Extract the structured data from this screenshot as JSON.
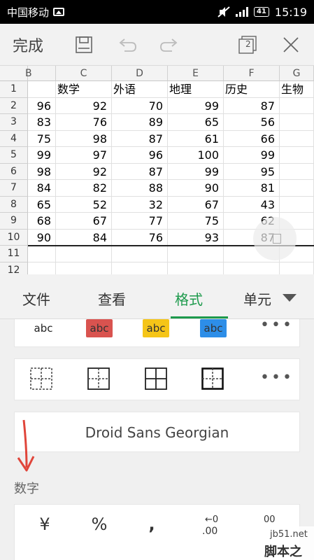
{
  "status": {
    "carrier": "中国移动",
    "battery": "41",
    "time": "15:19"
  },
  "toolbar": {
    "done_label": "完成",
    "window_count": "2"
  },
  "sheet": {
    "columns": [
      "B",
      "C",
      "D",
      "E",
      "F",
      "G"
    ],
    "rows": [
      "1",
      "2",
      "3",
      "4",
      "5",
      "6",
      "7",
      "8",
      "9",
      "10",
      "11",
      "12"
    ],
    "headers": [
      "数学",
      "外语",
      "地理",
      "历史",
      "生物"
    ],
    "data": [
      [
        "96",
        "92",
        "70",
        "99",
        "87"
      ],
      [
        "83",
        "76",
        "89",
        "65",
        "56"
      ],
      [
        "75",
        "98",
        "87",
        "61",
        "66"
      ],
      [
        "99",
        "97",
        "96",
        "100",
        "99"
      ],
      [
        "98",
        "92",
        "87",
        "99",
        "95"
      ],
      [
        "84",
        "82",
        "88",
        "90",
        "81"
      ],
      [
        "65",
        "52",
        "32",
        "67",
        "43"
      ],
      [
        "68",
        "67",
        "77",
        "75",
        "62"
      ],
      [
        "90",
        "84",
        "76",
        "93",
        "87"
      ]
    ]
  },
  "tabs": [
    "文件",
    "查看",
    "格式",
    "单元"
  ],
  "active_tab": "格式",
  "text_styles": [
    "abc",
    "abc",
    "abc",
    "abc"
  ],
  "swatch_colors": [
    "#ffffff",
    "#d9534f",
    "#f5c518",
    "#2d8ee8"
  ],
  "font_name": "Droid Sans Georgian",
  "number_section_label": "数字",
  "number_formats": [
    "¥",
    "%",
    ",",
    ".00"
  ],
  "watermark": {
    "line1": "jb51.net",
    "line2": "脚本之家"
  },
  "accent_color": "#1d9a4c"
}
